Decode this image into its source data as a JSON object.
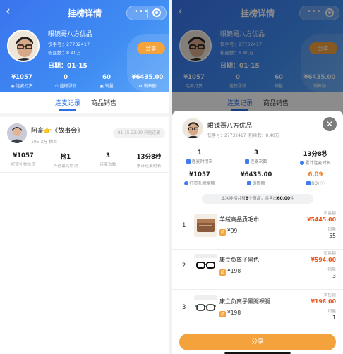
{
  "header": {
    "title": "挂榜详情",
    "back_glyph": "‹",
    "more_glyph": "•••"
  },
  "host": {
    "name": "眼镜哥八方优品",
    "id_line": "快手号：27732417",
    "fans_line": "粉丝数：8.40万",
    "date_line": "日期：01-15",
    "share_label": "分享"
  },
  "host_stats": [
    {
      "value": "¥1057",
      "label": "连麦打赏",
      "icon": "coin-icon"
    },
    {
      "value": "0",
      "label": "挂榜涨粉",
      "icon": "person-icon"
    },
    {
      "value": "60",
      "label": "销量",
      "icon": "bag-icon"
    },
    {
      "value": "¥6435.00",
      "label": "销售额",
      "icon": "gear-icon"
    }
  ],
  "tabs": [
    {
      "label": "连麦记录",
      "active": true
    },
    {
      "label": "商品销售",
      "active": false
    }
  ],
  "record": {
    "name": "阿豪👉《故事会》",
    "fans": "105.3万 粉丝",
    "time": "01-15 22:00 开始连麦",
    "stats": [
      {
        "value": "¥1057",
        "label": "打赏礼物价值"
      },
      {
        "value": "榜1",
        "label": "外送最高榜次"
      },
      {
        "value": "3",
        "label": "连麦次数"
      },
      {
        "value": "13分8秒",
        "label": "累计连麦时长"
      }
    ]
  },
  "sheet": {
    "host_name": "眼镜哥八方优品",
    "id_line": "快手号：27732417",
    "fans_line": "粉丝数：8.40万",
    "close_glyph": "✕",
    "stats_row1": [
      {
        "value": "1",
        "label": "连麦时榜次"
      },
      {
        "value": "3",
        "label": "连麦次数"
      },
      {
        "value": "13分8秒",
        "label": "累计连麦时长"
      }
    ],
    "stats_row2": [
      {
        "value": "¥1057",
        "label": "打赏礼物金额",
        "color": "#222222"
      },
      {
        "value": "¥6435.00",
        "label": "销售额",
        "color": "#222222"
      },
      {
        "value": "6.09",
        "label": "ROI",
        "color": "#f07b1c"
      }
    ],
    "summary": {
      "prefix": "本次挂榜共有",
      "count": "8",
      "middle": "个商品，共售出",
      "total": "60.00",
      "suffix": "件"
    },
    "sales_label": "销售额",
    "qty_label": "销量",
    "products": [
      {
        "index": "1",
        "title": "羊绒高品质毛巾",
        "price": "¥99",
        "sales": "¥5445.00",
        "qty": "55"
      },
      {
        "index": "2",
        "title": "康立负离子黑色",
        "price": "¥198",
        "sales": "¥594.00",
        "qty": "3"
      },
      {
        "index": "3",
        "title": "康立负离子黑腿裸腿",
        "price": "¥198",
        "sales": "¥198.00",
        "qty": "1"
      }
    ],
    "share_label": "分享"
  },
  "colors": {
    "brand_blue": "#3a74ee",
    "accent_orange": "#f3a23c",
    "price_red": "#e8581c"
  }
}
